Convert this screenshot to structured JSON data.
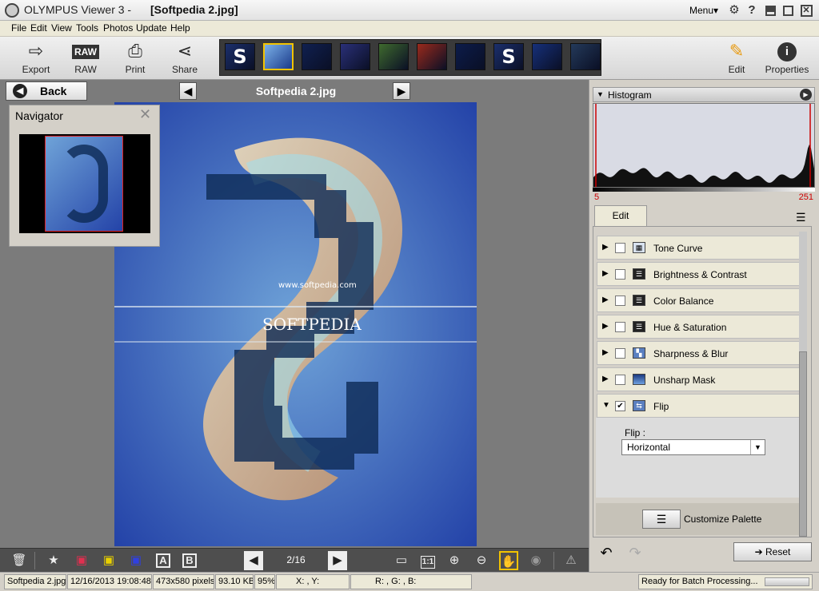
{
  "window": {
    "app_name": "OLYMPUS Viewer 3  -",
    "file_title": "[Softpedia 2.jpg]",
    "menu_label": "Menu▾"
  },
  "menubar": [
    "File",
    "Edit",
    "View",
    "Tools",
    "Photos",
    "Update",
    "Help"
  ],
  "toolbar": {
    "export": "Export",
    "raw": "RAW",
    "raw_icon_text": "RAW",
    "print": "Print",
    "share": "Share",
    "edit": "Edit",
    "properties": "Properties"
  },
  "thumbnails": [
    {
      "kind": "s-logo",
      "selected": false,
      "color": "#1b2f6b"
    },
    {
      "kind": "swirl",
      "selected": true,
      "color": "#2a4f9a"
    },
    {
      "kind": "dark-blue",
      "selected": false,
      "color": "#102050"
    },
    {
      "kind": "blue-purple",
      "selected": false,
      "color": "#2a3078"
    },
    {
      "kind": "forest",
      "selected": false,
      "color": "#3f6a2e"
    },
    {
      "kind": "flower",
      "selected": false,
      "color": "#9a2a1c"
    },
    {
      "kind": "dark-blue-2",
      "selected": false,
      "color": "#0c1c4a"
    },
    {
      "kind": "s-logo",
      "selected": false,
      "color": "#1b2f6b"
    },
    {
      "kind": "blue-streak",
      "selected": false,
      "color": "#16307a"
    },
    {
      "kind": "dark-swirl",
      "selected": false,
      "color": "#243a5a"
    }
  ],
  "thumb_letter": "S",
  "navbar": {
    "back_label": "Back",
    "image_title": "Softpedia 2.jpg"
  },
  "navigator": {
    "title": "Navigator"
  },
  "photo": {
    "watermark": "SOFTPEDIA",
    "url_text": "www.softpedia.com"
  },
  "bottombar": {
    "page_count": "2/16",
    "ratio_label": "1:1",
    "text_a": "A",
    "text_b": "B"
  },
  "statusbar": {
    "filename": "Softpedia 2.jpg",
    "datetime": "12/16/2013 19:08:48",
    "dimensions": "473x580 pixels",
    "filesize": "93.10 KB",
    "zoom": "95%",
    "coords": "X: , Y:",
    "rgb": "R: , G: , B:",
    "status": "Ready for Batch Processing..."
  },
  "histogram": {
    "title": "Histogram",
    "low": "5",
    "high": "251"
  },
  "edit_tab": "Edit",
  "palette": [
    {
      "label": "Tone Curve",
      "checked": false,
      "expanded": false,
      "icon": "tone-curve-icon"
    },
    {
      "label": "Brightness & Contrast",
      "checked": false,
      "expanded": false,
      "icon": "brightness-icon"
    },
    {
      "label": "Color Balance",
      "checked": false,
      "expanded": false,
      "icon": "color-balance-icon"
    },
    {
      "label": "Hue & Saturation",
      "checked": false,
      "expanded": false,
      "icon": "hue-icon"
    },
    {
      "label": "Sharpness & Blur",
      "checked": false,
      "expanded": false,
      "icon": "sharpness-icon"
    },
    {
      "label": "Unsharp Mask",
      "checked": false,
      "expanded": false,
      "icon": "unsharp-icon"
    },
    {
      "label": "Flip",
      "checked": true,
      "expanded": true,
      "icon": "flip-icon"
    }
  ],
  "flip": {
    "label": "Flip :",
    "value": "Horizontal"
  },
  "customize_label": "Customize Palette",
  "reset_label": "Reset",
  "colors": {
    "accent_yellow": "#f2c300",
    "histogram_marker": "#cc0000",
    "viewer_bg": "#7b7b7b"
  }
}
